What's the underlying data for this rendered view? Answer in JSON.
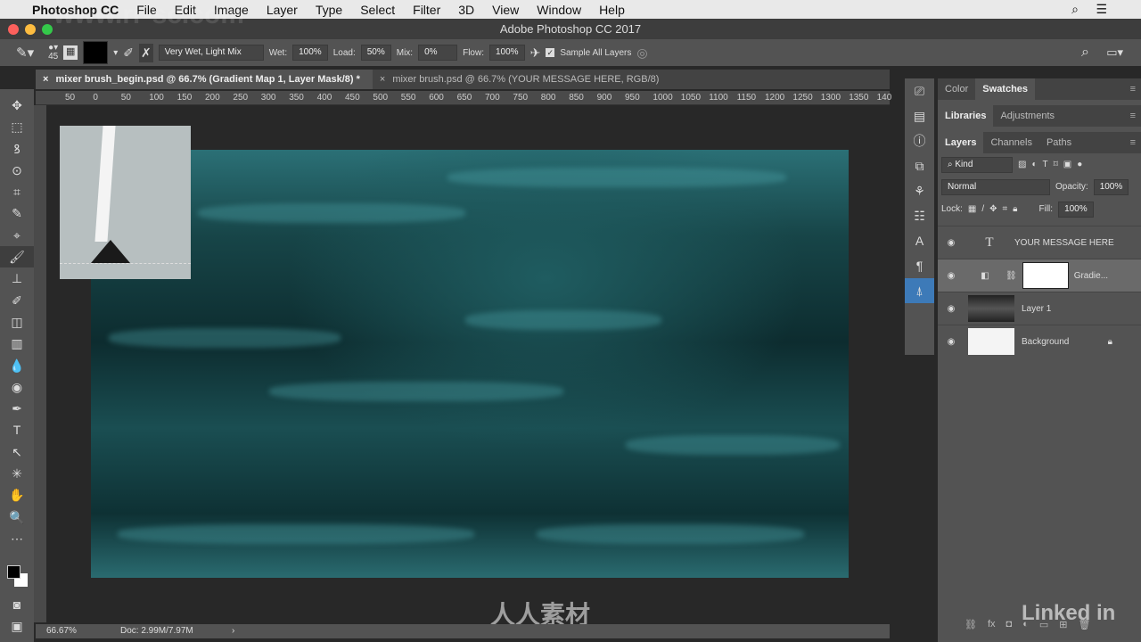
{
  "menubar": {
    "app": "Photoshop CC",
    "items": [
      "File",
      "Edit",
      "Image",
      "Layer",
      "Type",
      "Select",
      "Filter",
      "3D",
      "View",
      "Window",
      "Help"
    ]
  },
  "window": {
    "title": "Adobe Photoshop CC 2017"
  },
  "options": {
    "brush_size": "45",
    "preset": "Very Wet, Light Mix",
    "wet_label": "Wet:",
    "wet": "100%",
    "load_label": "Load:",
    "load": "50%",
    "mix_label": "Mix:",
    "mix": "0%",
    "flow_label": "Flow:",
    "flow": "100%",
    "sample_all_layers": "Sample All Layers",
    "sample_checked": true
  },
  "tabs": [
    {
      "label": "mixer brush_begin.psd @ 66.7% (Gradient Map 1, Layer Mask/8) *",
      "active": true
    },
    {
      "label": "mixer brush.psd @ 66.7% (YOUR MESSAGE HERE, RGB/8)",
      "active": false
    }
  ],
  "ruler_ticks": [
    "50",
    "0",
    "50",
    "100",
    "150",
    "200",
    "250",
    "300",
    "350",
    "400",
    "450",
    "500",
    "550",
    "600",
    "650",
    "700",
    "750",
    "800",
    "850",
    "900",
    "950",
    "1000",
    "1050",
    "1100",
    "1150",
    "1200",
    "1250",
    "1300",
    "1350",
    "140"
  ],
  "tools": [
    "✥",
    "⬚",
    "ꝸ",
    "⊙",
    "⌗",
    "✎",
    "⌖",
    "🖌",
    "⊥",
    "✐",
    "◫",
    "▥",
    "💧",
    "◉",
    "✒",
    "T",
    "↖",
    "✳",
    "✋",
    "🔍",
    "⋯"
  ],
  "status": {
    "zoom": "66.67%",
    "doc": "Doc: 2.99M/7.97M"
  },
  "panels": {
    "top_tabs": [
      "Color",
      "Swatches"
    ],
    "top_active": 1,
    "mid_tabs": [
      "Libraries",
      "Adjustments"
    ],
    "mid_active": 0,
    "layer_tabs": [
      "Layers",
      "Channels",
      "Paths"
    ],
    "layer_active": 0,
    "filter_kind": "Kind",
    "blend_mode": "Normal",
    "opacity_label": "Opacity:",
    "opacity": "100%",
    "lock_label": "Lock:",
    "fill_label": "Fill:",
    "fill": "100%",
    "layers": [
      {
        "name": "YOUR MESSAGE HERE",
        "type": "text"
      },
      {
        "name": "Gradie...",
        "type": "adjustment",
        "selected": true
      },
      {
        "name": "Layer 1",
        "type": "pixel"
      },
      {
        "name": "Background",
        "type": "background",
        "locked": true
      }
    ]
  },
  "watermark": {
    "site": "www.rr-sc.com",
    "brand": "人人素材",
    "linkedin": "Linked in"
  },
  "colors": {
    "accent_canvas": "#1f5c60",
    "panel": "#535353",
    "foreground": "#000000",
    "background": "#ffffff"
  }
}
